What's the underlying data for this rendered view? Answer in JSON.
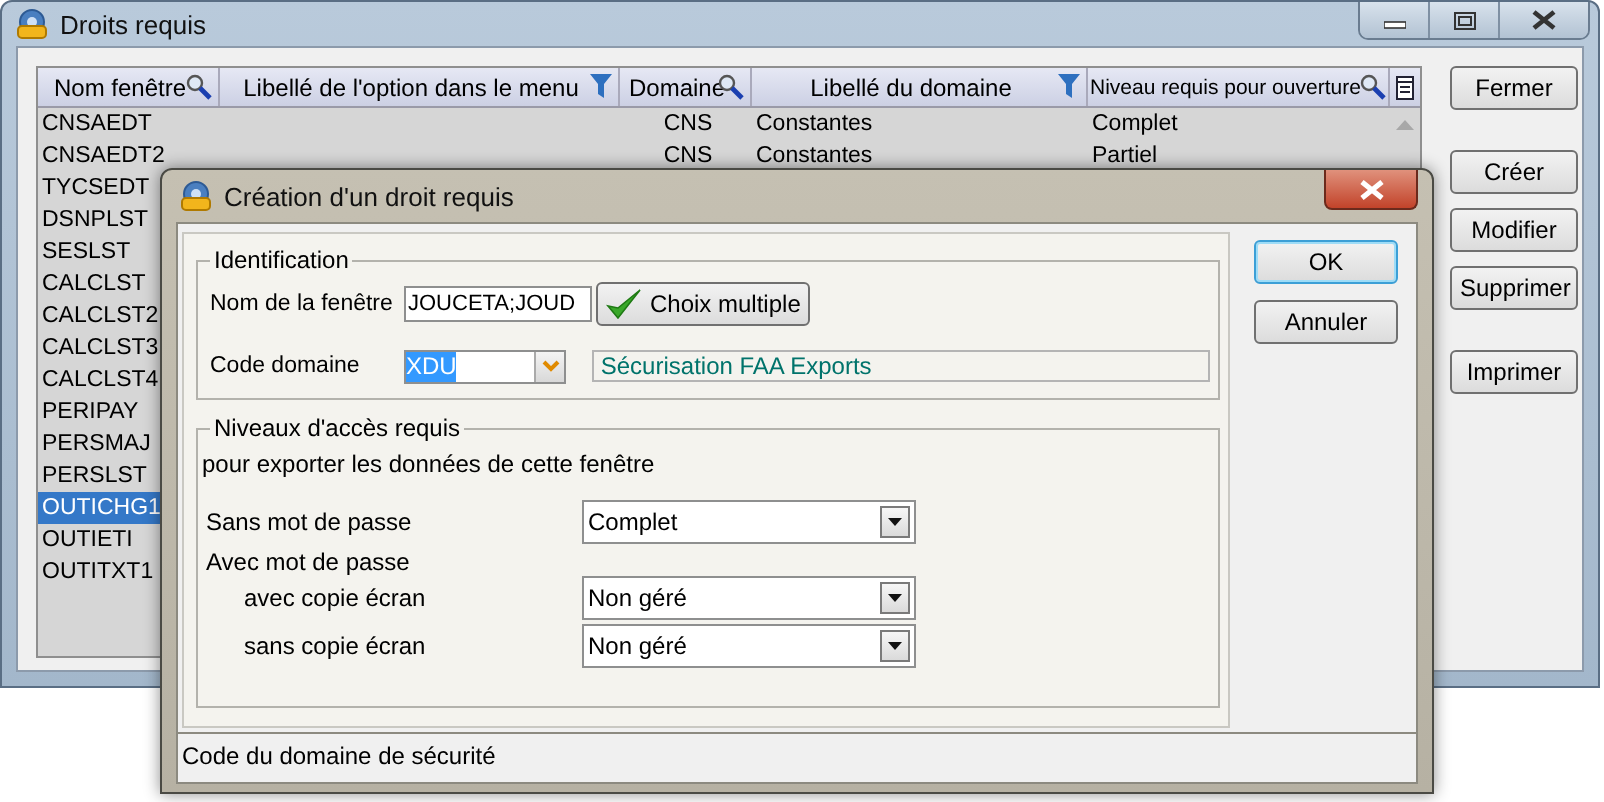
{
  "main_window": {
    "title": "Droits requis",
    "table": {
      "columns": [
        {
          "label": "Nom fenêtre",
          "kind": "search"
        },
        {
          "label": "Libellé de l'option dans le menu",
          "kind": "filter"
        },
        {
          "label": "Domaine",
          "kind": "search"
        },
        {
          "label": "Libellé du domaine",
          "kind": "filter"
        },
        {
          "label": "Niveau requis pour ouverture",
          "kind": "search"
        }
      ],
      "rows": [
        {
          "name": "CNSAEDT",
          "domain": "CNS",
          "domain_label": "Constantes",
          "required_level": "Complet",
          "selected": false
        },
        {
          "name": "CNSAEDT2",
          "domain": "CNS",
          "domain_label": "Constantes",
          "required_level": "Partiel",
          "selected": false
        },
        {
          "name": "TYCSEDT",
          "selected": false
        },
        {
          "name": "DSNPLST",
          "selected": false
        },
        {
          "name": "SESLST",
          "selected": false
        },
        {
          "name": "CALCLST",
          "selected": false
        },
        {
          "name": "CALCLST2",
          "selected": false
        },
        {
          "name": "CALCLST3",
          "selected": false
        },
        {
          "name": "CALCLST4",
          "selected": false
        },
        {
          "name": "PERIPAY",
          "selected": false
        },
        {
          "name": "PERSMAJ",
          "selected": false
        },
        {
          "name": "PERSLST",
          "selected": false
        },
        {
          "name": "OUTICHG1",
          "selected": true
        },
        {
          "name": "OUTIETI",
          "selected": false
        },
        {
          "name": "OUTITXT1",
          "selected": false
        }
      ]
    },
    "button_groups": [
      [
        "Fermer"
      ],
      [
        "Créer",
        "Modifier",
        "Supprimer"
      ],
      [
        "Imprimer"
      ]
    ]
  },
  "dialog": {
    "title": "Création d'un droit requis",
    "identification": {
      "title": "Identification",
      "fields": [
        {
          "kind": "text",
          "label": "Nom de la fenêtre",
          "value": "JOUCETA;JOUD",
          "button": "Choix multiple"
        },
        {
          "kind": "combo",
          "label": "Code domaine",
          "value": "XDU",
          "value_selected": true,
          "description": "Sécurisation FAA Exports"
        }
      ]
    },
    "levels": {
      "title": "Niveaux d'accès requis",
      "subtitle": "pour exporter les données de cette fenêtre",
      "rows": [
        {
          "kind": "combo",
          "label": "Sans mot de passe",
          "value": "Complet",
          "indented": false
        },
        {
          "kind": "heading",
          "label": "Avec mot de passe",
          "indented": false
        },
        {
          "kind": "combo",
          "label": "avec copie écran",
          "value": "Non géré",
          "indented": true
        },
        {
          "kind": "combo",
          "label": "sans copie écran",
          "value": "Non géré",
          "indented": true
        }
      ]
    },
    "buttons": [
      {
        "label": "OK",
        "default": true
      },
      {
        "label": "Annuler",
        "default": false
      }
    ],
    "status_bar": "Code du domaine de sécurité"
  }
}
